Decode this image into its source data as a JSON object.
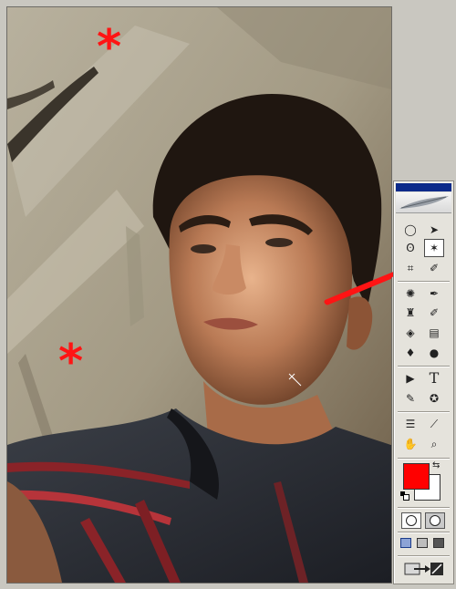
{
  "canvas": {
    "subject": "photo-portrait"
  },
  "annotations": {
    "star_glyph": "*",
    "color": "#ff1414"
  },
  "toolbox": {
    "header_icon": "feather-icon",
    "tools": [
      {
        "name": "marquee-icon",
        "glyph": "◯"
      },
      {
        "name": "move-icon",
        "glyph": "➤"
      },
      {
        "name": "lasso-icon",
        "glyph": "ʘ"
      },
      {
        "name": "magic-wand-icon",
        "glyph": "✶",
        "active": true
      },
      {
        "name": "crop-icon",
        "glyph": "⌗"
      },
      {
        "name": "slice-icon",
        "glyph": "✐"
      },
      {
        "name": "healing-brush-icon",
        "glyph": "✺"
      },
      {
        "name": "brush-icon",
        "glyph": "🖌"
      },
      {
        "name": "stamp-icon",
        "glyph": "♜"
      },
      {
        "name": "history-brush-icon",
        "glyph": "✒"
      },
      {
        "name": "eraser-icon",
        "glyph": "◈"
      },
      {
        "name": "gradient-icon",
        "glyph": "▤"
      },
      {
        "name": "blur-icon",
        "glyph": "💧"
      },
      {
        "name": "dodge-icon",
        "glyph": "●"
      },
      {
        "name": "path-select-icon",
        "glyph": "▶"
      },
      {
        "name": "type-icon",
        "glyph": "T"
      },
      {
        "name": "pen-icon",
        "glyph": "✎"
      },
      {
        "name": "shape-icon",
        "glyph": "✪"
      },
      {
        "name": "notes-icon",
        "glyph": "☰"
      },
      {
        "name": "eyedropper-icon",
        "glyph": "⟋"
      },
      {
        "name": "hand-icon",
        "glyph": "✋"
      },
      {
        "name": "zoom-icon",
        "glyph": "🔍"
      }
    ],
    "foreground_color": "#ff0000",
    "background_color": "#ffffff",
    "swap_icon": "swap-colors-icon",
    "default_icon": "default-colors-icon"
  }
}
